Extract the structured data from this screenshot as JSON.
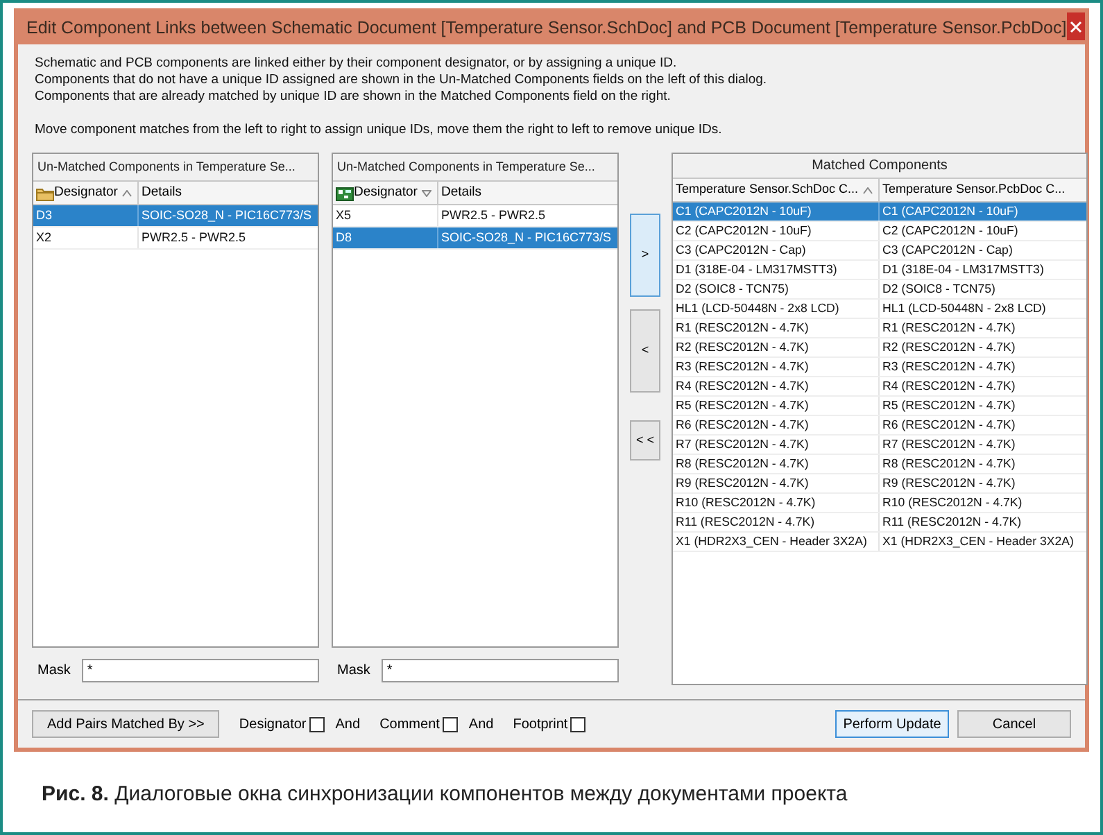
{
  "window": {
    "title": "Edit Component Links between Schematic Document [Temperature Sensor.SchDoc] and PCB Document [Temperature Sensor.PcbDoc]"
  },
  "intro": [
    [
      "Schematic and PCB components are linked either by their component designator, or by assigning a unique ID.",
      "Components that do not have a unique ID assigned are shown in the Un-Matched Components fields on the left of this dialog.",
      "Components that are already matched by unique ID are shown in the Matched Components field on the right."
    ],
    [
      "Move component matches from the left to right to assign unique IDs, move them the right to left to remove unique IDs."
    ]
  ],
  "unmatched_panels": [
    {
      "title": "Un-Matched Components in Temperature Se...",
      "columns": [
        {
          "label": "Designator",
          "sort_ascending": true,
          "sort_descending": false
        },
        {
          "label": "Details",
          "sort_ascending": false,
          "sort_descending": false
        }
      ],
      "rows": [
        {
          "designator": "D3",
          "details": "SOIC-SO28_N - PIC16C773/S",
          "selected": true
        },
        {
          "designator": "X2",
          "details": "PWR2.5 - PWR2.5",
          "selected": false
        }
      ],
      "mask": {
        "label": "Mask",
        "value": "*"
      }
    },
    {
      "title": "Un-Matched Components in Temperature Se...",
      "columns": [
        {
          "label": "Designator",
          "sort_ascending": false,
          "sort_descending": true
        },
        {
          "label": "Details",
          "sort_ascending": false,
          "sort_descending": false
        }
      ],
      "rows": [
        {
          "designator": "X5",
          "details": "PWR2.5 - PWR2.5",
          "selected": false
        },
        {
          "designator": "D8",
          "details": "SOIC-SO28_N - PIC16C773/S",
          "selected": true
        }
      ],
      "mask": {
        "label": "Mask",
        "value": "*"
      }
    }
  ],
  "move_buttons": [
    {
      "label": ">",
      "hovered": true
    },
    {
      "label": "<",
      "hovered": false
    },
    {
      "label": "< <",
      "hovered": false
    }
  ],
  "matched": {
    "title": "Matched Components",
    "columns": [
      {
        "label": "Temperature Sensor.SchDoc C...",
        "sort_ascending": true,
        "sort_descending": false
      },
      {
        "label": "Temperature Sensor.PcbDoc C...",
        "sort_ascending": false,
        "sort_descending": false
      }
    ],
    "rows": [
      {
        "cells": [
          "C1 (CAPC2012N - 10uF)",
          "C1 (CAPC2012N - 10uF)"
        ],
        "selected": true
      },
      {
        "cells": [
          "C2 (CAPC2012N - 10uF)",
          "C2 (CAPC2012N - 10uF)"
        ],
        "selected": false
      },
      {
        "cells": [
          "C3 (CAPC2012N - Cap)",
          "C3 (CAPC2012N - Cap)"
        ],
        "selected": false
      },
      {
        "cells": [
          "D1 (318E-04 - LM317MSTT3)",
          "D1 (318E-04 - LM317MSTT3)"
        ],
        "selected": false
      },
      {
        "cells": [
          "D2 (SOIC8 - TCN75)",
          "D2 (SOIC8 - TCN75)"
        ],
        "selected": false
      },
      {
        "cells": [
          "HL1 (LCD-50448N - 2x8 LCD)",
          "HL1 (LCD-50448N - 2x8 LCD)"
        ],
        "selected": false
      },
      {
        "cells": [
          "R1 (RESC2012N - 4.7K)",
          "R1 (RESC2012N - 4.7K)"
        ],
        "selected": false
      },
      {
        "cells": [
          "R2 (RESC2012N - 4.7K)",
          "R2 (RESC2012N - 4.7K)"
        ],
        "selected": false
      },
      {
        "cells": [
          "R3 (RESC2012N - 4.7K)",
          "R3 (RESC2012N - 4.7K)"
        ],
        "selected": false
      },
      {
        "cells": [
          "R4 (RESC2012N - 4.7K)",
          "R4 (RESC2012N - 4.7K)"
        ],
        "selected": false
      },
      {
        "cells": [
          "R5 (RESC2012N - 4.7K)",
          "R5 (RESC2012N - 4.7K)"
        ],
        "selected": false
      },
      {
        "cells": [
          "R6 (RESC2012N - 4.7K)",
          "R6 (RESC2012N - 4.7K)"
        ],
        "selected": false
      },
      {
        "cells": [
          "R7 (RESC2012N - 4.7K)",
          "R7 (RESC2012N - 4.7K)"
        ],
        "selected": false
      },
      {
        "cells": [
          "R8 (RESC2012N - 4.7K)",
          "R8 (RESC2012N - 4.7K)"
        ],
        "selected": false
      },
      {
        "cells": [
          "R9 (RESC2012N - 4.7K)",
          "R9 (RESC2012N - 4.7K)"
        ],
        "selected": false
      },
      {
        "cells": [
          "R10 (RESC2012N - 4.7K)",
          "R10 (RESC2012N - 4.7K)"
        ],
        "selected": false
      },
      {
        "cells": [
          "R11 (RESC2012N - 4.7K)",
          "R11 (RESC2012N - 4.7K)"
        ],
        "selected": false
      },
      {
        "cells": [
          "X1 (HDR2X3_CEN - Header 3X2A)",
          "X1 (HDR2X3_CEN - Header 3X2A)"
        ],
        "selected": false
      }
    ]
  },
  "footer": {
    "add_pairs_button": "Add Pairs Matched By >>",
    "match_options": [
      {
        "kind": "checkbox",
        "label": "Designator",
        "checked": false
      },
      {
        "kind": "text",
        "label": "And"
      },
      {
        "kind": "checkbox",
        "label": "Comment",
        "checked": false
      },
      {
        "kind": "text",
        "label": "And"
      },
      {
        "kind": "checkbox",
        "label": "Footprint",
        "checked": false
      }
    ],
    "buttons": [
      {
        "label": "Perform Update",
        "default": true
      },
      {
        "label": "Cancel",
        "default": false
      }
    ]
  },
  "caption": "**Рис. 8.** Диалоговые окна синхронизации компонентов между документами проекта"
}
